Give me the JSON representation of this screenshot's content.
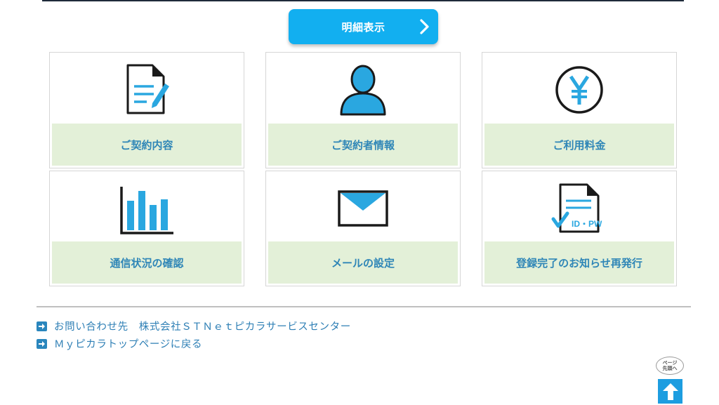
{
  "header": {
    "detail_button_label": "明細表示"
  },
  "tiles": [
    {
      "label": "ご契約内容",
      "icon": "document-edit-icon"
    },
    {
      "label": "ご契約者情報",
      "icon": "user-icon"
    },
    {
      "label": "ご利用料金",
      "icon": "yen-icon"
    },
    {
      "label": "通信状況の確認",
      "icon": "bar-chart-icon"
    },
    {
      "label": "メールの設定",
      "icon": "mail-icon"
    },
    {
      "label": "登録完了のお知らせ再発行",
      "icon": "id-pw-document-icon",
      "icon_text": "ID・PW"
    }
  ],
  "links": [
    {
      "label": "お問い合わせ先　株式会社ＳＴＮｅｔピカラサービスセンター"
    },
    {
      "label": "Ｍｙピカラトップページに戻る"
    }
  ],
  "page_top": {
    "label": "ページ\n先頭へ",
    "icon": "arrow-up-icon"
  },
  "colors": {
    "accent": "#12aff0",
    "tile_band": "#e3f0d8",
    "tile_label": "#2f86b7",
    "icon_blue": "#2aa7e0",
    "link": "#2e7fb5"
  }
}
